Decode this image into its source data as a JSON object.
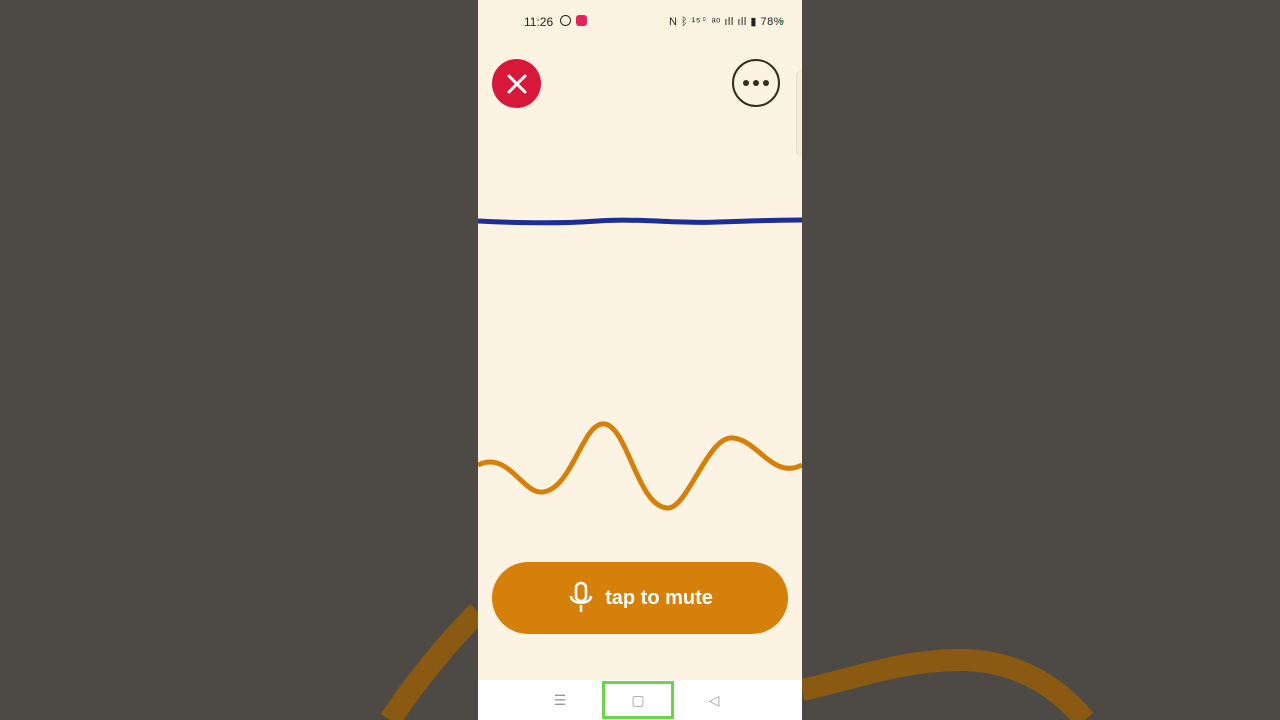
{
  "status_bar": {
    "time": "11:26",
    "indicators": "N  ᛒ  ¹⁵⁰  ᵃᵒ  ıll  ıll  ▮",
    "battery": "78%"
  },
  "icons": {
    "close": "close-icon",
    "more": "more-horizontal-icon",
    "mic": "microphone-icon",
    "whatsapp": "whatsapp-icon",
    "youtube": "youtube-icon"
  },
  "controls": {
    "mute_label": "tap to mute"
  },
  "nav": {
    "menu_glyph": "☰",
    "home_glyph": "▢",
    "back_glyph": "◁"
  },
  "colors": {
    "background": "#4d4a45",
    "phone_bg": "#fdf3e3",
    "close_red": "#d7183a",
    "blue_wave": "#1a2f9a",
    "orange_wave": "#d4800a",
    "highlight_green": "#6cd44a"
  }
}
